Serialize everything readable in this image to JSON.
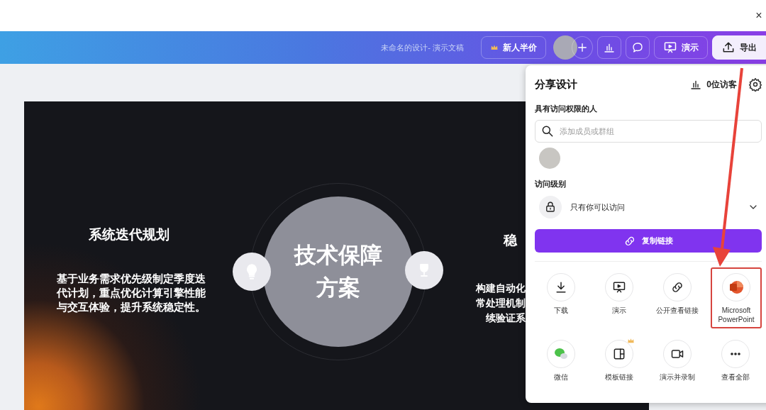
{
  "window": {
    "close": "×"
  },
  "topbar": {
    "title": "未命名的设计- 演示文稿",
    "promo_label": "新人半价",
    "present_label": "演示",
    "export_label": "导出"
  },
  "slide": {
    "left_heading": "系统迭代规划",
    "left_body": "基于业务需求优先级制定季度迭代计划，重点优化计算引擎性能与交互体验，提升系统稳定性。",
    "center_title": "技术保障方案",
    "right_heading": "稳",
    "right_body_lines": [
      "构建自动化",
      "常处理机制",
      "续验证系"
    ]
  },
  "share_panel": {
    "title": "分享设计",
    "visitors": "0位访客",
    "people_heading": "具有访问权限的人",
    "search": {
      "placeholder": "添加成员或群组"
    },
    "access_heading": "访问级别",
    "access_value": "只有你可以访问",
    "copy_button": "复制链接",
    "items": [
      {
        "label": "下载",
        "highlighted": false,
        "premium": false
      },
      {
        "label": "演示",
        "highlighted": false,
        "premium": false
      },
      {
        "label": "公开查看链接",
        "highlighted": false,
        "premium": false
      },
      {
        "label": "Microsoft PowerPoint",
        "highlighted": true,
        "premium": false
      },
      {
        "label": "微信",
        "highlighted": false,
        "premium": false
      },
      {
        "label": "模板链接",
        "highlighted": false,
        "premium": true
      },
      {
        "label": "演示并录制",
        "highlighted": false,
        "premium": false
      },
      {
        "label": "查看全部",
        "highlighted": false,
        "premium": false
      }
    ]
  }
}
